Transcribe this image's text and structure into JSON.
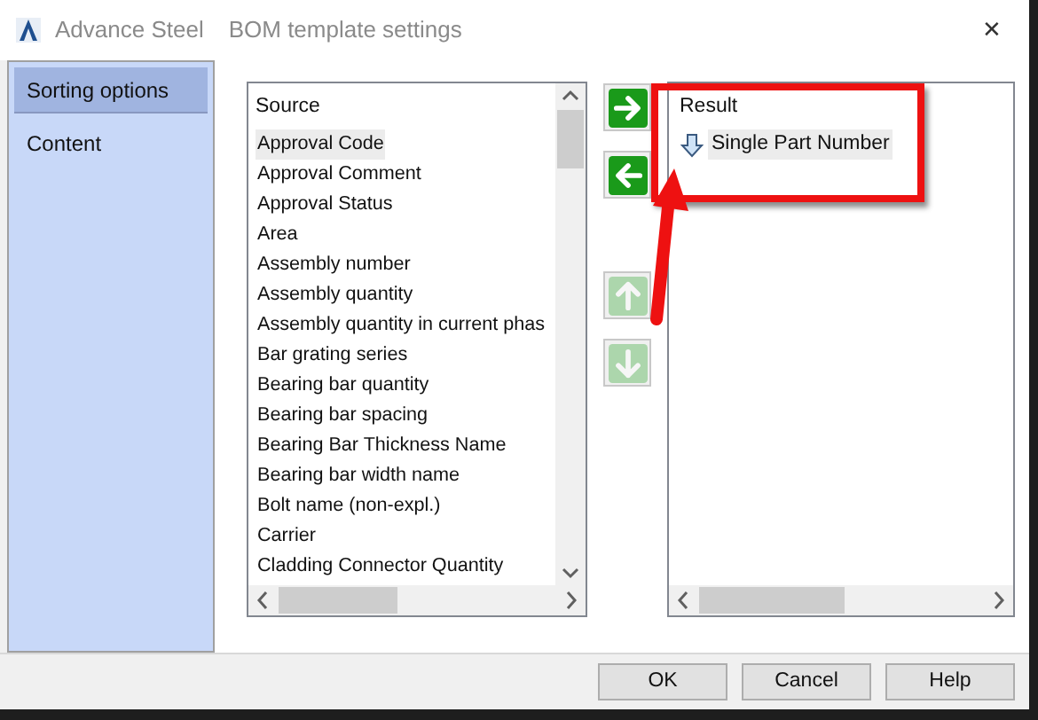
{
  "window": {
    "app": "Advance Steel",
    "title": "BOM template settings",
    "close": "✕"
  },
  "sidebar": {
    "items": [
      {
        "label": "Sorting options",
        "selected": true
      },
      {
        "label": "Content",
        "selected": false
      }
    ]
  },
  "source": {
    "header": "Source",
    "items": [
      {
        "label": "Approval Code",
        "selected": true
      },
      {
        "label": "Approval Comment",
        "selected": false
      },
      {
        "label": "Approval Status",
        "selected": false
      },
      {
        "label": "Area",
        "selected": false
      },
      {
        "label": "Assembly number",
        "selected": false
      },
      {
        "label": "Assembly quantity",
        "selected": false
      },
      {
        "label": "Assembly quantity in current phas",
        "selected": false
      },
      {
        "label": "Bar grating series",
        "selected": false
      },
      {
        "label": "Bearing bar quantity",
        "selected": false
      },
      {
        "label": "Bearing bar spacing",
        "selected": false
      },
      {
        "label": "Bearing Bar Thickness Name",
        "selected": false
      },
      {
        "label": "Bearing bar width name",
        "selected": false
      },
      {
        "label": "Bolt name (non-expl.)",
        "selected": false
      },
      {
        "label": "Carrier",
        "selected": false
      },
      {
        "label": "Cladding Connector Quantity",
        "selected": false
      }
    ]
  },
  "move_buttons": [
    {
      "kind": "add",
      "disabled": false
    },
    {
      "kind": "remove",
      "disabled": false
    },
    {
      "kind": "up",
      "disabled": true
    },
    {
      "kind": "down",
      "disabled": true
    }
  ],
  "result": {
    "header": "Result",
    "items": [
      {
        "label": "Single Part Number",
        "selected": true
      }
    ]
  },
  "buttons": [
    "OK",
    "Cancel",
    "Help"
  ]
}
